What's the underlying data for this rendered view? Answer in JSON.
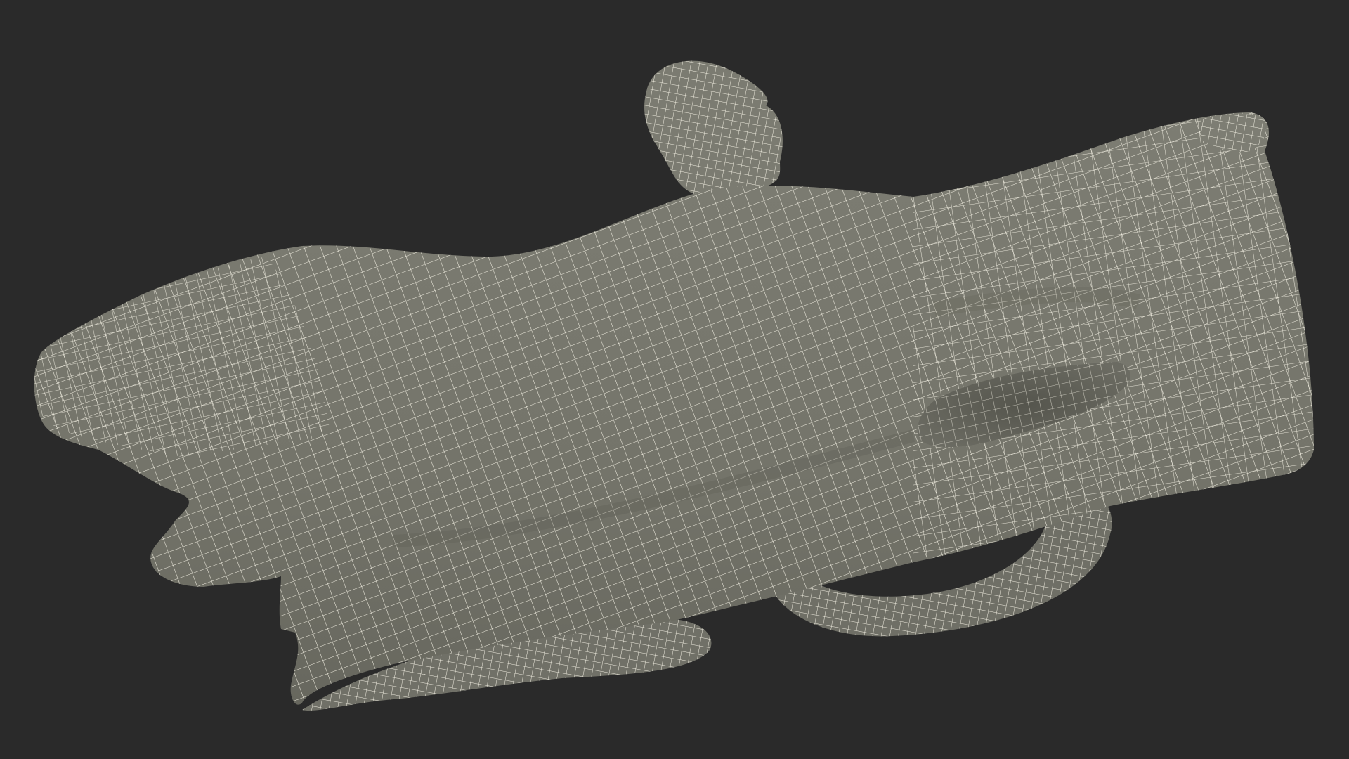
{
  "scene": {
    "subject": "glove-wireframe-model",
    "colors": {
      "background": "#2a2a2a",
      "surface": "#77776d",
      "surface_shadow": "#5e5e55",
      "surface_highlight": "#8a8a80",
      "wire": "#f2efe2"
    }
  }
}
